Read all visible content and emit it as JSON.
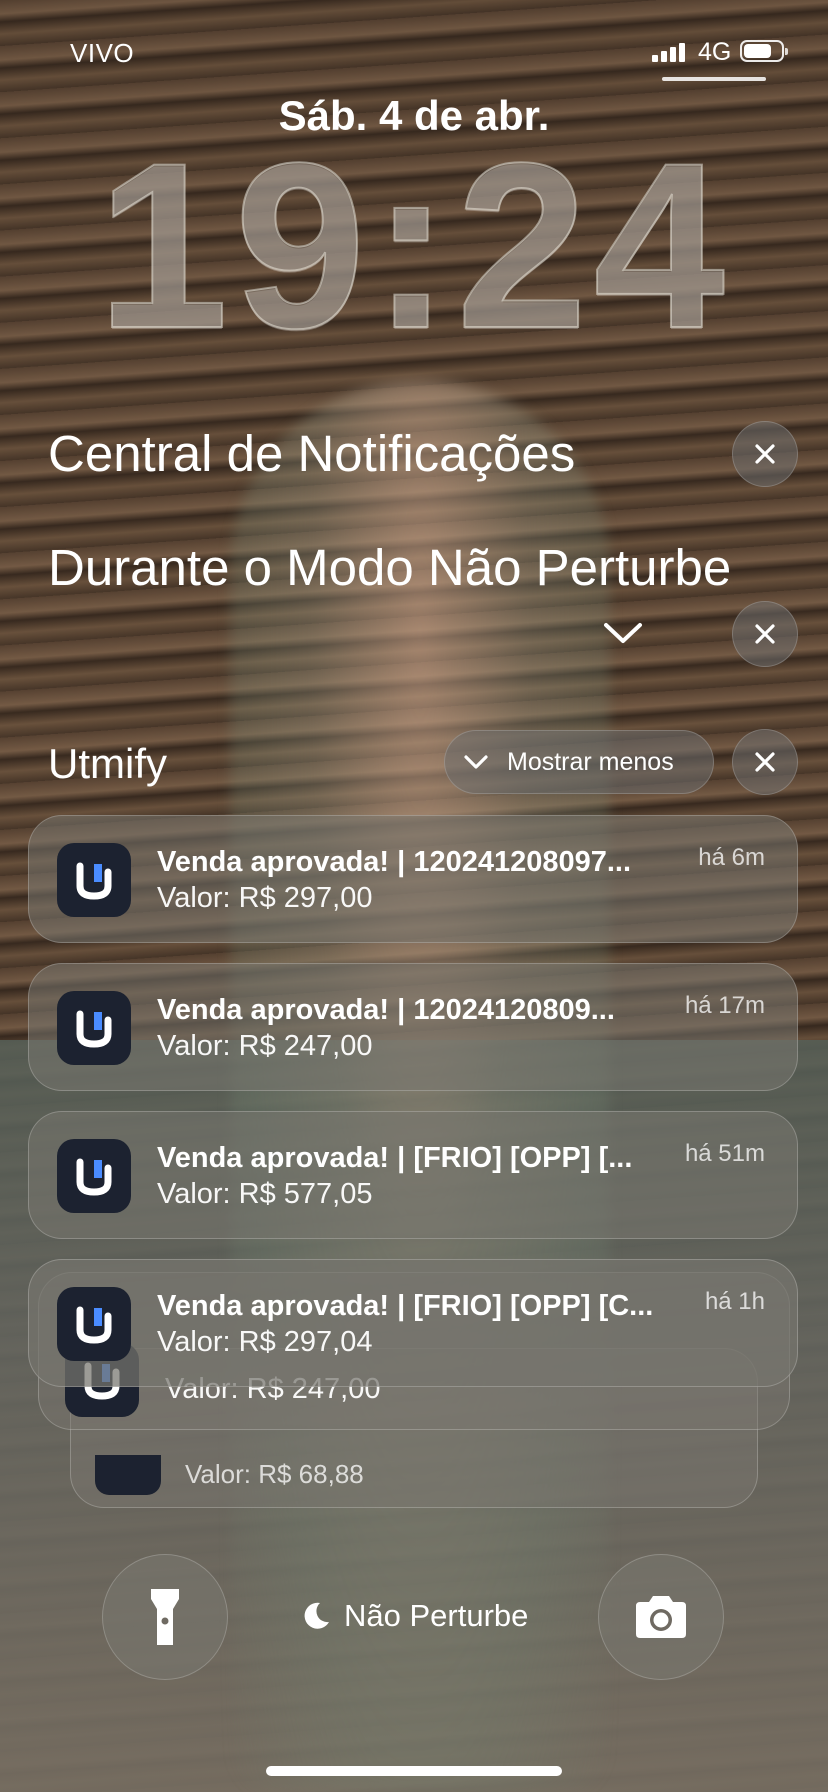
{
  "status_bar": {
    "carrier": "VIVO",
    "network": "4G",
    "signal_bars": 4,
    "battery_level": 0.75
  },
  "lock_screen": {
    "date": "Sáb. 4 de abr.",
    "time": "19:24"
  },
  "notification_center": {
    "title": "Central de Notificações",
    "dnd_section_title": "Durante o Modo Não Perturbe",
    "group": {
      "app_name": "Utmify",
      "show_less_label": "Mostrar menos",
      "notifications": [
        {
          "title": "Venda aprovada! | 120241208097...",
          "body": "Valor: R$ 297,00",
          "time": "há 6m"
        },
        {
          "title": "Venda aprovada! | 12024120809...",
          "body": "Valor: R$ 247,00",
          "time": "há 17m"
        },
        {
          "title": "Venda aprovada! | [FRIO] [OPP] [...",
          "body": "Valor: R$ 577,05",
          "time": "há 51m"
        },
        {
          "title": "Venda aprovada! | [FRIO] [OPP] [C...",
          "body": "Valor: R$ 297,04",
          "time": "há 1h"
        }
      ],
      "stacked": [
        {
          "body": "Valor: R$ 247,00"
        },
        {
          "body": "Valor: R$ 68,88"
        }
      ]
    }
  },
  "bottom_bar": {
    "focus_label": "Não Perturbe",
    "left_icon": "flashlight-icon",
    "right_icon": "camera-icon"
  }
}
